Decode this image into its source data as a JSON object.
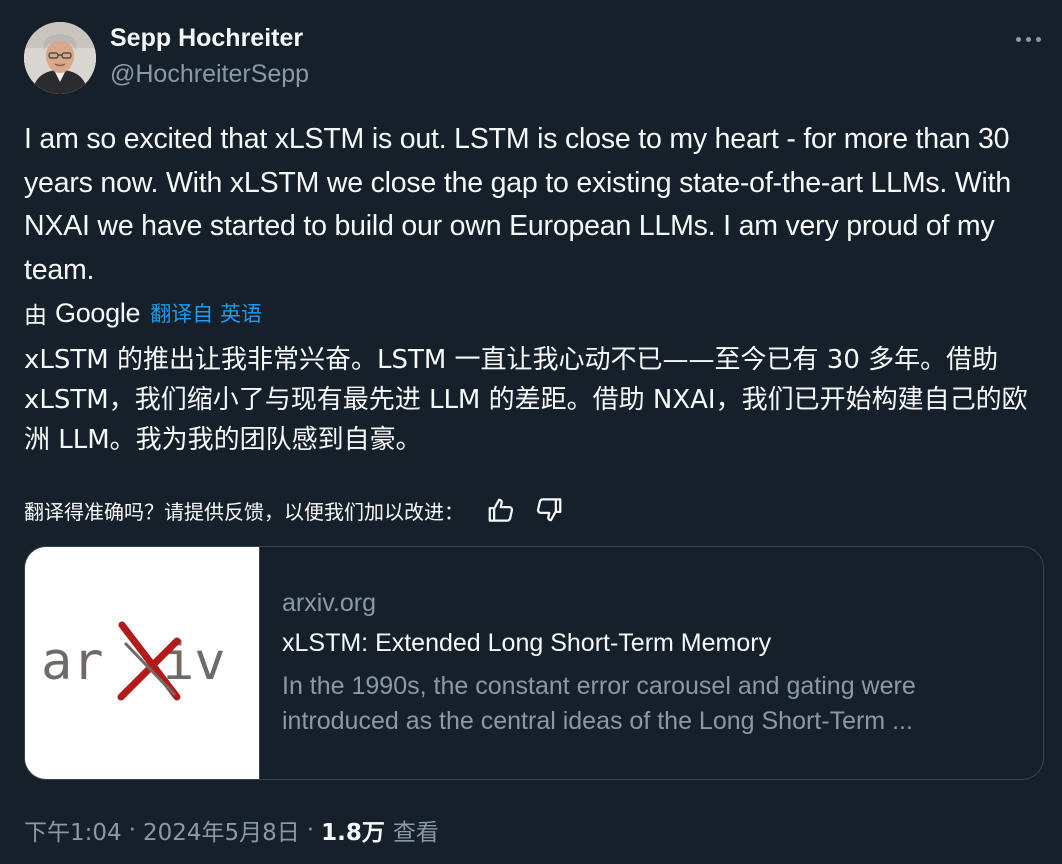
{
  "author": {
    "display_name": "Sepp Hochreiter",
    "handle": "@HochreiterSepp",
    "avatar_icon": "profile-photo"
  },
  "more_icon": "more-horizontal-icon",
  "tweet": {
    "text": "I am so excited that xLSTM is out. LSTM is close to my heart - for more than 30 years now. With xLSTM we close the gap to existing state-of-the-art LLMs. With NXAI we have started to build our own European LLMs. I am very proud of my team."
  },
  "translation": {
    "by_label": "由",
    "provider": "Google",
    "from_label": "翻译自 英语",
    "text": "xLSTM 的推出让我非常兴奋。LSTM 一直让我心动不已——至今已有 30 多年。借助 xLSTM，我们缩小了与现有最先进 LLM 的差距。借助 NXAI，我们已开始构建自己的欧洲 LLM。我为我的团队感到自豪。",
    "feedback_question": "翻译得准确吗？请提供反馈，以便我们加以改进：",
    "thumbs_up_icon": "thumbs-up-icon",
    "thumbs_down_icon": "thumbs-down-icon"
  },
  "card": {
    "logo_text": "arXiv",
    "domain": "arxiv.org",
    "title": "xLSTM: Extended Long Short-Term Memory",
    "description": "In the 1990s, the constant error carousel and gating were introduced as the central ideas of the Long Short-Term ..."
  },
  "meta": {
    "time": "下午1:04",
    "separator": "·",
    "date": "2024年5月8日",
    "views_count": "1.8万",
    "views_label": "查看"
  },
  "colors": {
    "background": "#15202b",
    "text_primary": "#f7f9f9",
    "text_secondary": "#8b98a5",
    "accent": "#1d9bf0",
    "border": "#38444d",
    "arxiv_gray": "#6f6a66",
    "arxiv_red": "#b31b1b"
  }
}
